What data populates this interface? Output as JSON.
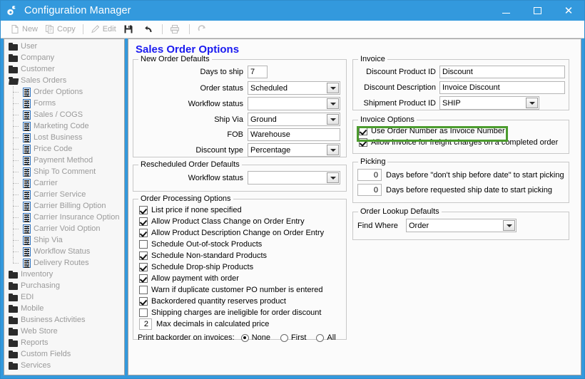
{
  "window": {
    "title": "Configuration Manager",
    "icon": "gear-icon",
    "controls": {
      "minimize": "–",
      "maximize": "☐",
      "close": "✕"
    }
  },
  "toolbar": {
    "items": [
      {
        "label": "New",
        "icon": "new-page-icon",
        "enabled": false
      },
      {
        "label": "Copy",
        "icon": "copy-icon",
        "enabled": false
      },
      {
        "label": "Edit",
        "icon": "pencil-icon",
        "enabled": false
      },
      {
        "label": "",
        "icon": "save-icon",
        "enabled": true
      },
      {
        "label": "",
        "icon": "undo-icon",
        "enabled": true
      },
      {
        "label": "",
        "icon": "print-icon",
        "enabled": false
      },
      {
        "label": "",
        "icon": "refresh-icon",
        "enabled": false
      }
    ]
  },
  "sidebar": {
    "items": [
      {
        "label": "User",
        "level": 0,
        "icon": "folder-icon"
      },
      {
        "label": "Company",
        "level": 0,
        "icon": "folder-icon"
      },
      {
        "label": "Customer",
        "level": 0,
        "icon": "folder-icon"
      },
      {
        "label": "Sales Orders",
        "level": 0,
        "icon": "folder-open-icon",
        "expanded": true
      },
      {
        "label": "Order Options",
        "level": 1,
        "icon": "form-icon",
        "selected": true
      },
      {
        "label": "Forms",
        "level": 1,
        "icon": "form-icon"
      },
      {
        "label": "Sales / COGS",
        "level": 1,
        "icon": "form-icon"
      },
      {
        "label": "Marketing Code",
        "level": 1,
        "icon": "form-icon"
      },
      {
        "label": "Lost Business",
        "level": 1,
        "icon": "form-icon"
      },
      {
        "label": "Price Code",
        "level": 1,
        "icon": "form-icon"
      },
      {
        "label": "Payment Method",
        "level": 1,
        "icon": "form-icon"
      },
      {
        "label": "Ship To Comment",
        "level": 1,
        "icon": "form-icon"
      },
      {
        "label": "Carrier",
        "level": 1,
        "icon": "form-icon"
      },
      {
        "label": "Carrier Service",
        "level": 1,
        "icon": "form-icon"
      },
      {
        "label": "Carrier Billing Option",
        "level": 1,
        "icon": "form-icon"
      },
      {
        "label": "Carrier Insurance Option",
        "level": 1,
        "icon": "form-icon"
      },
      {
        "label": "Carrier Void Option",
        "level": 1,
        "icon": "form-icon"
      },
      {
        "label": "Ship Via",
        "level": 1,
        "icon": "form-icon"
      },
      {
        "label": "Workflow Status",
        "level": 1,
        "icon": "form-icon"
      },
      {
        "label": "Delivery Routes",
        "level": 1,
        "icon": "form-icon",
        "last": true
      },
      {
        "label": "Inventory",
        "level": 0,
        "icon": "folder-icon"
      },
      {
        "label": "Purchasing",
        "level": 0,
        "icon": "folder-icon"
      },
      {
        "label": "EDI",
        "level": 0,
        "icon": "folder-icon"
      },
      {
        "label": "Mobile",
        "level": 0,
        "icon": "folder-icon"
      },
      {
        "label": "Business Activities",
        "level": 0,
        "icon": "folder-icon"
      },
      {
        "label": "Web Store",
        "level": 0,
        "icon": "folder-icon"
      },
      {
        "label": "Reports",
        "level": 0,
        "icon": "folder-icon"
      },
      {
        "label": "Custom Fields",
        "level": 0,
        "icon": "folder-icon"
      },
      {
        "label": "Services",
        "level": 0,
        "icon": "folder-icon"
      }
    ]
  },
  "content": {
    "page_title": "Sales Order Options",
    "new_order_defaults": {
      "title": "New Order Defaults",
      "days_to_ship": {
        "label": "Days to ship",
        "value": "7"
      },
      "order_status": {
        "label": "Order status",
        "value": "Scheduled"
      },
      "workflow_status": {
        "label": "Workflow status",
        "value": ""
      },
      "ship_via": {
        "label": "Ship Via",
        "value": "Ground"
      },
      "fob": {
        "label": "FOB",
        "value": "Warehouse"
      },
      "discount_type": {
        "label": "Discount type",
        "value": "Percentage"
      }
    },
    "rescheduled_order_defaults": {
      "title": "Rescheduled Order Defaults",
      "workflow_status": {
        "label": "Workflow status",
        "value": ""
      }
    },
    "order_processing_options": {
      "title": "Order Processing Options",
      "checkboxes": [
        {
          "label": "List price if none specified",
          "checked": true
        },
        {
          "label": "Allow Product Class Change on Order Entry",
          "checked": true
        },
        {
          "label": "Allow Product Description Change on Order Entry",
          "checked": true
        },
        {
          "label": "Schedule Out-of-stock Products",
          "checked": false
        },
        {
          "label": "Schedule Non-standard Products",
          "checked": true
        },
        {
          "label": "Schedule Drop-ship Products",
          "checked": true
        },
        {
          "label": "Allow payment with order",
          "checked": true
        },
        {
          "label": "Warn if duplicate customer PO number is entered",
          "checked": false
        },
        {
          "label": "Backordered quantity reserves product",
          "checked": true
        },
        {
          "label": "Shipping charges are ineligible for order discount",
          "checked": false
        }
      ],
      "max_decimals": {
        "value": "2",
        "label": "Max decimals in calculated price"
      },
      "print_backorder": {
        "label": "Print backorder on invoices:",
        "options": [
          {
            "label": "None",
            "selected": true
          },
          {
            "label": "First",
            "selected": false
          },
          {
            "label": "All",
            "selected": false
          }
        ]
      }
    },
    "invoice": {
      "title": "Invoice",
      "discount_product_id": {
        "label": "Discount Product ID",
        "value": "Discount"
      },
      "discount_description": {
        "label": "Discount Description",
        "value": "Invoice Discount"
      },
      "shipment_product_id": {
        "label": "Shipment Product ID",
        "value": "SHIP"
      }
    },
    "invoice_options": {
      "title": "Invoice Options",
      "checkboxes": [
        {
          "label": "Use Order Number as Invoice Number",
          "checked": true,
          "highlighted": true
        },
        {
          "label": "Allow invoice for freight charges on a completed order",
          "checked": true,
          "highlighted": false
        }
      ]
    },
    "picking": {
      "title": "Picking",
      "rows": [
        {
          "value": "0",
          "label": "Days before \"don't ship before date\" to start picking"
        },
        {
          "value": "0",
          "label": "Days before requested ship date to start picking"
        }
      ]
    },
    "order_lookup_defaults": {
      "title": "Order Lookup Defaults",
      "find_where": {
        "label": "Find Where",
        "value": "Order"
      }
    }
  },
  "colors": {
    "titlebar": "#3399dd",
    "page_title": "#1a1af0",
    "highlight": "#4c9c2e",
    "groupbox_border": "#c8c8c8"
  }
}
